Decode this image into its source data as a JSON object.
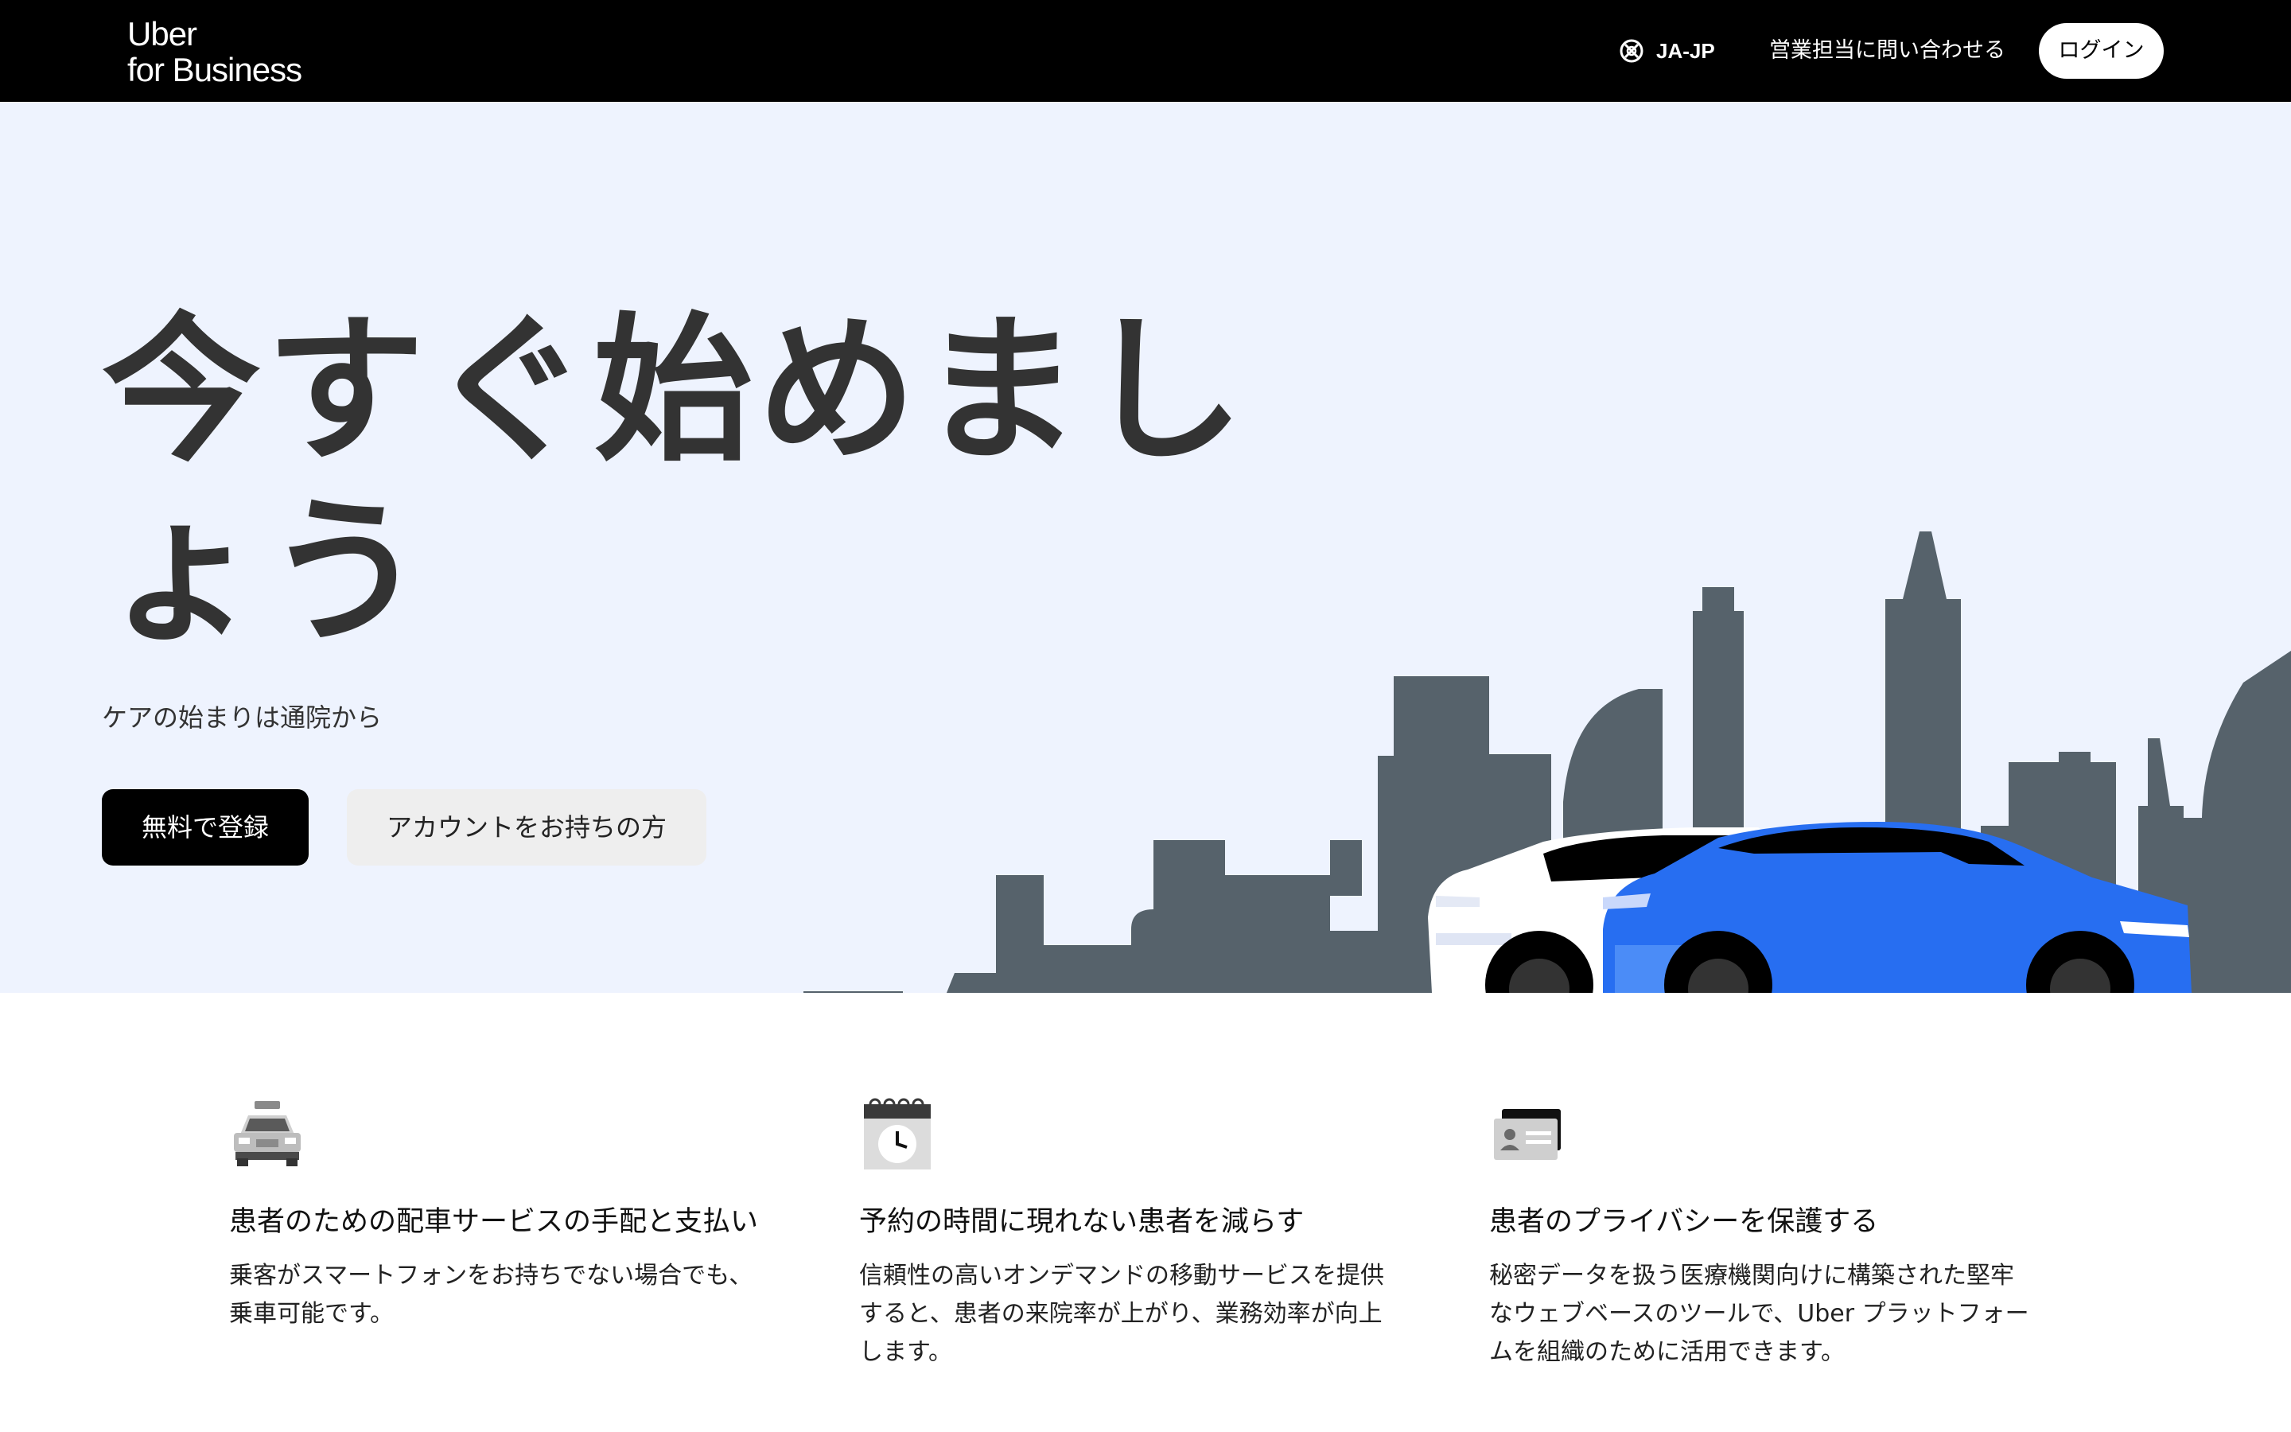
{
  "header": {
    "logo_line1": "Uber",
    "logo_line2": "for Business",
    "language": "JA-JP",
    "language_icon": "globe-icon",
    "contact_sales": "営業担当に問い合わせる",
    "login": "ログイン"
  },
  "hero": {
    "title": "今すぐ始めましょう",
    "subtitle": "ケアの始まりは通院から",
    "primary_button": "無料で登録",
    "secondary_button": "アカウントをお持ちの方",
    "colors": {
      "background": "#eef3fe",
      "skyline": "#56626b",
      "car_blue": "#276ef1",
      "car_white": "#ffffff"
    }
  },
  "features": [
    {
      "icon": "taxi-icon",
      "title": "患者のための配車サービスの手配と支払い",
      "line1": "乗客がスマートフォンをお持ちでない場合でも、",
      "line2": "乗車可能です。",
      "line3": ""
    },
    {
      "icon": "calendar-clock-icon",
      "title": "予約の時間に現れない患者を減らす",
      "line1": "信頼性の高いオンデマンドの移動サービスを提供",
      "line2": "すると、患者の来院率が上がり、業務効率が向上",
      "line3": "します。"
    },
    {
      "icon": "id-card-icon",
      "title": "患者のプライバシーを保護する",
      "line1": "秘密データを扱う医療機関向けに構築された堅牢",
      "line2": "なウェブベースのツールで、Uber プラットフォー",
      "line3": "ムを組織のために活用できます。"
    }
  ]
}
